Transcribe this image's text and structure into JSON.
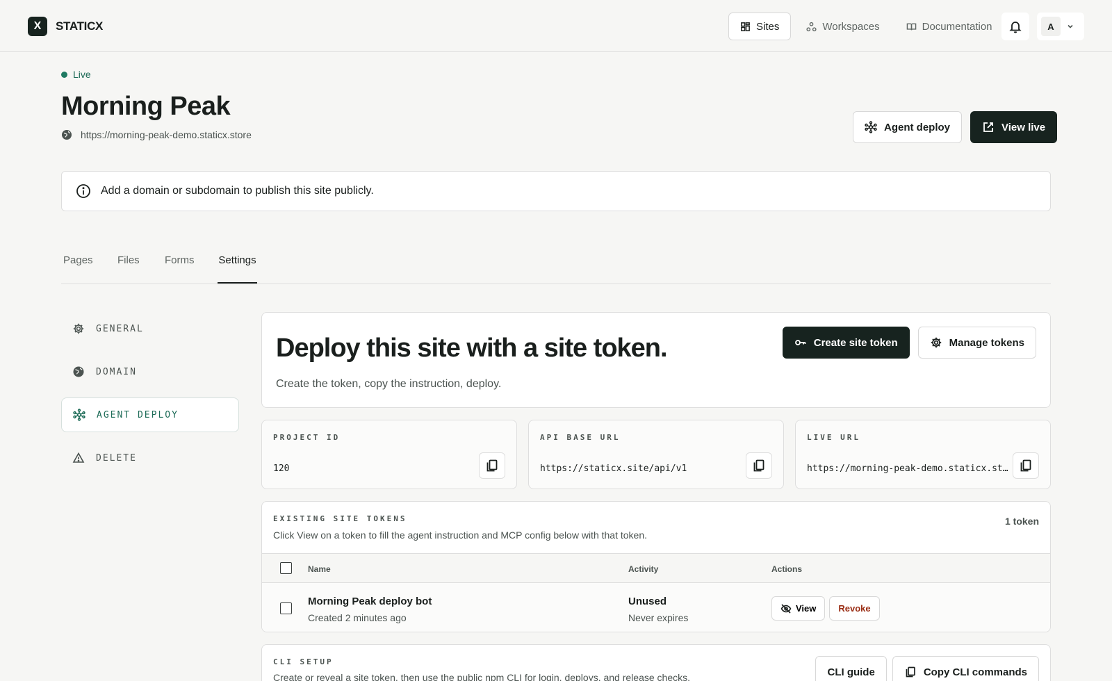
{
  "brand": {
    "logo_letter": "X",
    "name": "STATICX"
  },
  "nav": {
    "items": [
      {
        "label": "Sites",
        "icon": "grid-icon",
        "active": true
      },
      {
        "label": "Workspaces",
        "icon": "workspaces-icon",
        "active": false
      },
      {
        "label": "Documentation",
        "icon": "book-icon",
        "active": false
      }
    ],
    "avatar_initial": "A"
  },
  "site": {
    "status": "Live",
    "title": "Morning Peak",
    "url": "https://morning-peak-demo.staticx.store",
    "agent_deploy_label": "Agent deploy",
    "view_live_label": "View live"
  },
  "notice": {
    "text": "Add a domain or subdomain to publish this site publicly."
  },
  "tabs": [
    {
      "label": "Pages"
    },
    {
      "label": "Files"
    },
    {
      "label": "Forms"
    },
    {
      "label": "Settings",
      "active": true
    }
  ],
  "sidebar": {
    "items": [
      {
        "label": "GENERAL",
        "icon": "gear-icon"
      },
      {
        "label": "DOMAIN",
        "icon": "globe-icon"
      },
      {
        "label": "AGENT DEPLOY",
        "icon": "network-icon",
        "active": true
      },
      {
        "label": "DELETE",
        "icon": "warning-icon"
      }
    ]
  },
  "hero": {
    "title": "Deploy this site with a site token.",
    "subtitle": "Create the token, copy the instruction, deploy.",
    "create_label": "Create site token",
    "manage_label": "Manage tokens"
  },
  "info": {
    "project_id": {
      "label": "PROJECT ID",
      "value": "120"
    },
    "api_base": {
      "label": "API BASE URL",
      "value": "https://staticx.site/api/v1"
    },
    "live_url": {
      "label": "LIVE URL",
      "value": "https://morning-peak-demo.staticx.store"
    }
  },
  "tokens": {
    "label": "EXISTING SITE TOKENS",
    "help": "Click View on a token to fill the agent instruction and MCP config below with that token.",
    "count": "1 token",
    "columns": {
      "name": "Name",
      "activity": "Activity",
      "actions": "Actions"
    },
    "rows": [
      {
        "name": "Morning Peak deploy bot",
        "created": "Created 2 minutes ago",
        "activity": "Unused",
        "expiry": "Never expires",
        "view_label": "View",
        "revoke_label": "Revoke"
      }
    ]
  },
  "cli": {
    "label": "CLI SETUP",
    "help": "Create or reveal a site token, then use the public npm CLI for login, deploys, and release checks.",
    "guide_label": "CLI guide",
    "copy_label": "Copy CLI commands"
  },
  "colors": {
    "accent": "#1f7a62",
    "dark": "#17231f",
    "danger": "#9a2d14",
    "background": "#f6f6f4"
  }
}
